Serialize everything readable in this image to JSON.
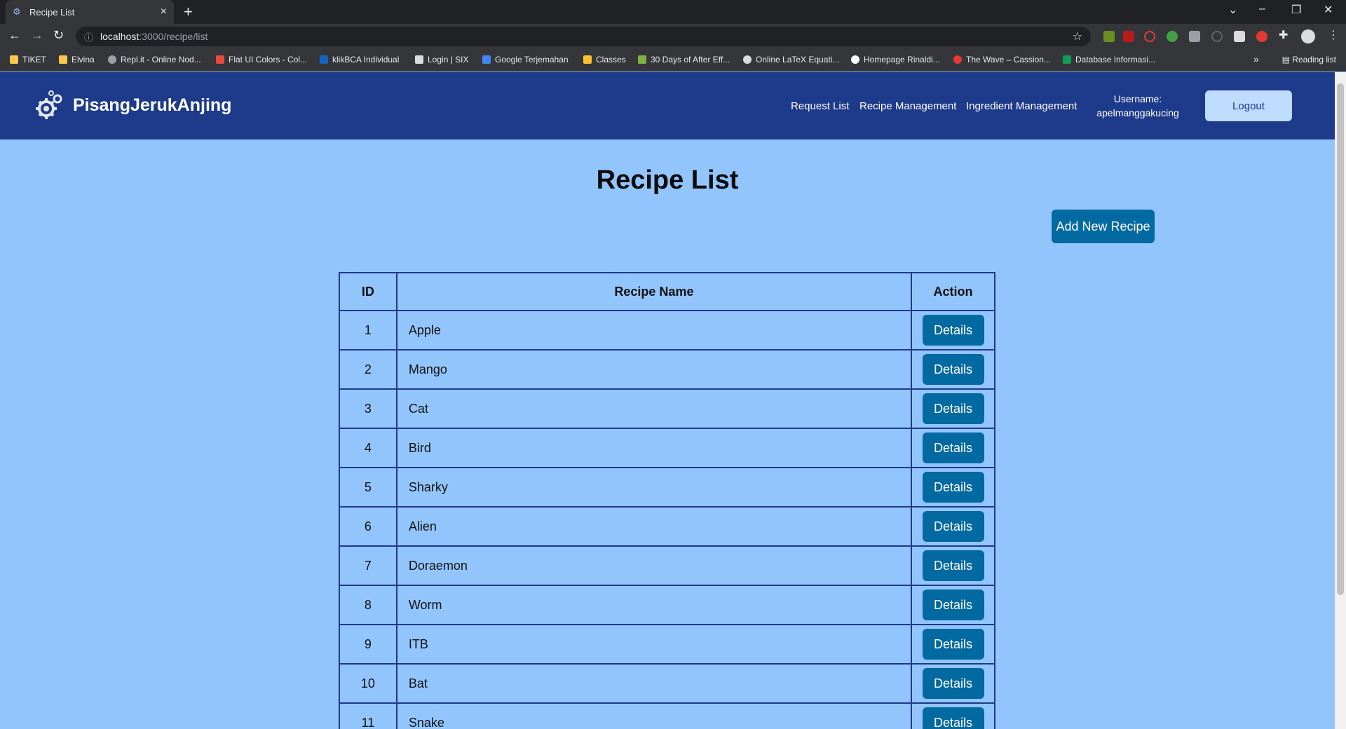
{
  "browser": {
    "tab_title": "Recipe List",
    "url_host": "localhost",
    "url_path": ":3000/recipe/list",
    "bookmarks": [
      "TIKET",
      "Elvina",
      "Repl.it - Online Nod...",
      "Flat UI Colors - Col...",
      "klikBCA Individual",
      "Login | SIX",
      "Google Terjemahan",
      "Classes",
      "30 Days of After Eff...",
      "Online LaTeX Equati...",
      "Homepage Rinaldi...",
      "The Wave – Cassion...",
      "Database Informasi..."
    ],
    "reading_list": "Reading list"
  },
  "nav": {
    "brand": "PisangJerukAnjing",
    "links": [
      "Request List",
      "Recipe Management",
      "Ingredient Management"
    ],
    "username_label": "Username:",
    "username": "apelmanggakucing",
    "logout": "Logout"
  },
  "page": {
    "title": "Recipe List",
    "add_button": "Add New Recipe"
  },
  "table": {
    "headers": [
      "ID",
      "Recipe Name",
      "Action"
    ],
    "action_label": "Details",
    "rows": [
      {
        "id": "1",
        "name": "Apple"
      },
      {
        "id": "2",
        "name": "Mango"
      },
      {
        "id": "3",
        "name": "Cat"
      },
      {
        "id": "4",
        "name": "Bird"
      },
      {
        "id": "5",
        "name": "Sharky"
      },
      {
        "id": "6",
        "name": "Alien"
      },
      {
        "id": "7",
        "name": "Doraemon"
      },
      {
        "id": "8",
        "name": "Worm"
      },
      {
        "id": "9",
        "name": "ITB"
      },
      {
        "id": "10",
        "name": "Bat"
      },
      {
        "id": "11",
        "name": "Snake"
      }
    ]
  },
  "colors": {
    "navbar": "#1e3a8a",
    "page_bg": "#93c5fd",
    "button": "#0369a1"
  }
}
